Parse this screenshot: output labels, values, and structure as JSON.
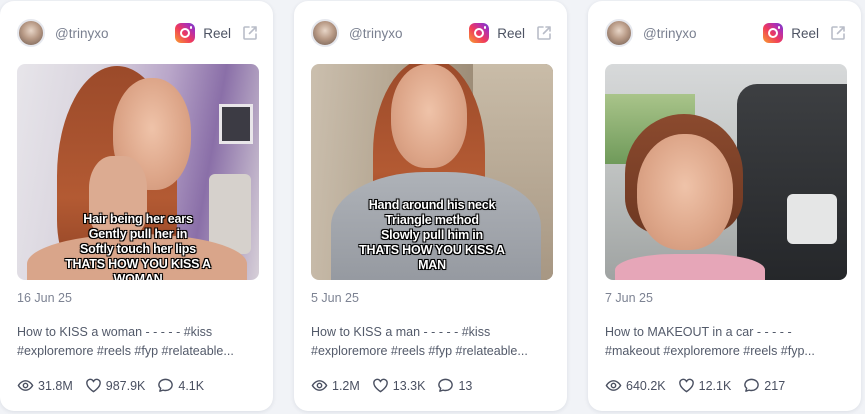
{
  "colors": {
    "page_bg": "#f1f3f7",
    "card_bg": "#ffffff",
    "text": "#4a5061",
    "muted": "#7d8393"
  },
  "cards": [
    {
      "handle": "@trinyxo",
      "platform_icon": "instagram-icon",
      "type_label": "Reel",
      "caption": "Hair being her ears\nGently pull her in\nSoftly touch her lips\nTHATS HOW YOU KISS A\nWOMAN",
      "date": "16 Jun 25",
      "description_line1": "How to KISS a woman - - - - - #kiss",
      "description_line2": "#exploremore #reels #fyp #relateable...",
      "views": "31.8M",
      "likes": "987.9K",
      "comments": "4.1K"
    },
    {
      "handle": "@trinyxo",
      "platform_icon": "instagram-icon",
      "type_label": "Reel",
      "caption": "Hand around his neck\nTriangle method\nSlowly pull him in\nTHATS HOW YOU KISS A\nMAN",
      "date": "5 Jun 25",
      "description_line1": "How to KISS a man - - - - - #kiss",
      "description_line2": "#exploremore #reels #fyp #relateable...",
      "views": "1.2M",
      "likes": "13.3K",
      "comments": "13"
    },
    {
      "handle": "@trinyxo",
      "platform_icon": "instagram-icon",
      "type_label": "Reel",
      "caption": "",
      "date": "7 Jun 25",
      "description_line1": "How to MAKEOUT in a car - - - - -",
      "description_line2": "#makeout #exploremore #reels #fyp...",
      "views": "640.2K",
      "likes": "12.1K",
      "comments": "217"
    }
  ]
}
